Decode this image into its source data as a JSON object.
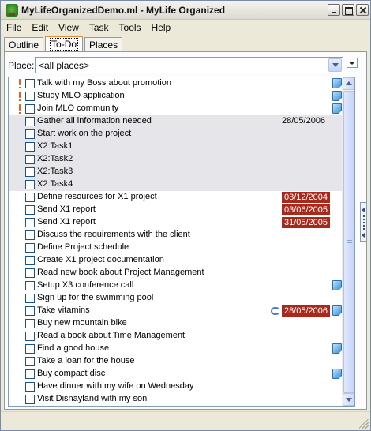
{
  "window": {
    "title": "MyLifeOrganizedDemo.ml - MyLife Organized"
  },
  "menu": [
    "File",
    "Edit",
    "View",
    "Task",
    "Tools",
    "Help"
  ],
  "tabs": [
    {
      "label": "Outline",
      "active": false
    },
    {
      "label": "To-Do",
      "active": true
    },
    {
      "label": "Places",
      "active": false
    }
  ],
  "place": {
    "label": "Place:",
    "value": "<all places>"
  },
  "colors": {
    "overdue_badge": "#a8281b",
    "grey_row": "#e6e6ea",
    "flag": "#e0631a",
    "tab_accent": "#e68b2c"
  },
  "tasks": [
    {
      "text": "Talk with my Boss about promotion",
      "flag": true,
      "note": true
    },
    {
      "text": "Study MLO application",
      "flag": true,
      "note": true
    },
    {
      "text": "Join MLO community",
      "flag": true,
      "note": true
    },
    {
      "text": "Gather all information needed",
      "grey": true,
      "date": "28/05/2006"
    },
    {
      "text": "Start work on the project",
      "grey": true
    },
    {
      "text": "X2:Task1",
      "grey": true
    },
    {
      "text": "X2:Task2",
      "grey": true
    },
    {
      "text": "X2:Task3",
      "grey": true
    },
    {
      "text": "X2:Task4",
      "grey": true
    },
    {
      "text": "Define resources for X1 project",
      "overdue": "03/12/2004"
    },
    {
      "text": "Send X1 report",
      "overdue": "03/06/2005"
    },
    {
      "text": "Send X1 report",
      "overdue": "31/05/2005"
    },
    {
      "text": "Discuss the requirements with the client"
    },
    {
      "text": "Define Project schedule"
    },
    {
      "text": "Create X1 project documentation"
    },
    {
      "text": "Read new book about Project Management"
    },
    {
      "text": "Setup X3 conference call",
      "note": true
    },
    {
      "text": "Sign up for the swimming pool"
    },
    {
      "text": "Take vitamins",
      "overdue": "28/05/2006",
      "recurring": true,
      "note": true
    },
    {
      "text": "Buy new mountain bike"
    },
    {
      "text": "Read a book about Time Management"
    },
    {
      "text": "Find a good house",
      "note": true
    },
    {
      "text": "Take a loan for the house"
    },
    {
      "text": "Buy compact disc",
      "note": true
    },
    {
      "text": "Have dinner with my wife on Wednesday"
    },
    {
      "text": "Visit Disnayland with my son"
    }
  ]
}
